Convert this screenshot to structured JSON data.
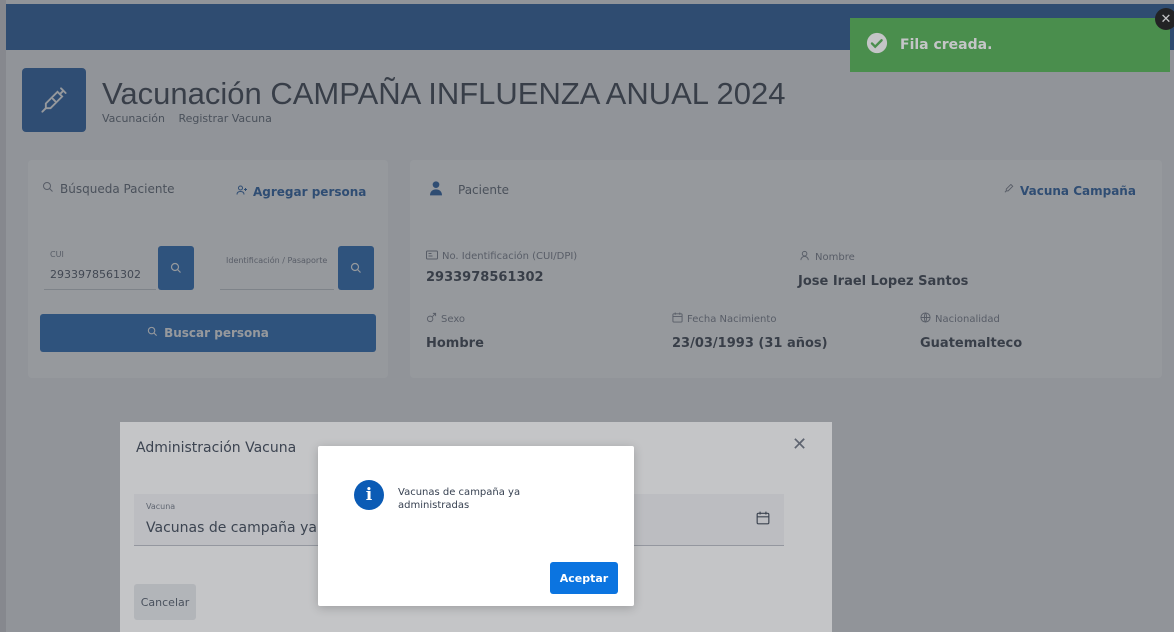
{
  "page": {
    "title": "Vacunación CAMPAÑA INFLUENZA ANUAL 2024",
    "breadcrumb": [
      "Vacunación",
      "Registrar Vacuna"
    ]
  },
  "search_panel": {
    "label": "Búsqueda Paciente",
    "add_person_label": "Agregar persona",
    "cui_field": {
      "label": "CUI",
      "value": "2933978561302"
    },
    "id_field": {
      "label": "Identificación / Pasaporte",
      "value": ""
    },
    "search_button_label": "Buscar persona"
  },
  "patient_panel": {
    "label": "Paciente",
    "campaign_link": "Vacuna Campaña",
    "fields": {
      "id_label": "No. Identificación (CUI/DPI)",
      "id_value": "2933978561302",
      "name_label": "Nombre",
      "name_value": "Jose Irael Lopez Santos",
      "sex_label": "Sexo",
      "sex_value": "Hombre",
      "birth_label": "Fecha Nacimiento",
      "birth_value": "23/03/1993 (31 años)",
      "nationality_label": "Nacionalidad",
      "nationality_value": "Guatemalteco"
    }
  },
  "toast": {
    "message": "Fila creada."
  },
  "modal": {
    "title": "Administración Vacuna",
    "vaccine_label": "Vacuna",
    "vaccine_value": "Vacunas de campaña ya ad",
    "cancel_label": "Cancelar"
  },
  "dialog": {
    "message": "Vacunas de campaña ya administradas",
    "accept_label": "Aceptar"
  },
  "colors": {
    "primary": "#0b4c9c",
    "success": "#4cae4c",
    "accent_button": "#0b74e0"
  }
}
